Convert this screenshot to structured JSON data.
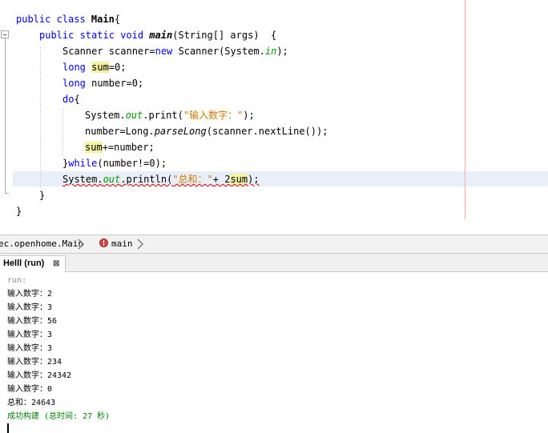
{
  "editor": {
    "lines": [
      {
        "segments": [
          {
            "t": "public class ",
            "c": "kw"
          },
          {
            "t": "Main",
            "c": "kw-bold"
          },
          {
            "t": "{"
          }
        ]
      },
      {
        "segments": [
          {
            "t": "public static void ",
            "c": "kw"
          },
          {
            "t": "main",
            "c": "kw-bold mth"
          },
          {
            "t": "(String[] args)  {"
          }
        ]
      },
      {
        "segments": [
          {
            "t": "Scanner scanner="
          },
          {
            "t": "new ",
            "c": "kw"
          },
          {
            "t": "Scanner(System."
          },
          {
            "t": "in",
            "c": "fld"
          },
          {
            "t": ");"
          }
        ]
      },
      {
        "segments": [
          {
            "t": "long ",
            "c": "kw"
          },
          {
            "t": "sum",
            "c": "mark"
          },
          {
            "t": "=0;"
          }
        ]
      },
      {
        "segments": [
          {
            "t": "long ",
            "c": "kw"
          },
          {
            "t": "number=0;"
          }
        ]
      },
      {
        "segments": [
          {
            "t": "do",
            "c": "kw"
          },
          {
            "t": "{"
          }
        ]
      },
      {
        "segments": [
          {
            "t": "System."
          },
          {
            "t": "out",
            "c": "fld"
          },
          {
            "t": ".print("
          },
          {
            "t": "\"输入数字：\"",
            "c": "str"
          },
          {
            "t": ");"
          }
        ]
      },
      {
        "segments": [
          {
            "t": "number=Long."
          },
          {
            "t": "parseLong",
            "c": "mth"
          },
          {
            "t": "(scanner.nextLine());"
          }
        ]
      },
      {
        "segments": [
          {
            "t": "sum",
            "c": "mark"
          },
          {
            "t": "+=number;"
          }
        ]
      },
      {
        "segments": [
          {
            "t": "}"
          },
          {
            "t": "while",
            "c": "kw"
          },
          {
            "t": "(number!=0);"
          }
        ]
      },
      {
        "segments": [
          {
            "t": "System."
          },
          {
            "t": "out",
            "c": "fld"
          },
          {
            "t": ".println("
          },
          {
            "t": "\"总和：\"",
            "c": "str"
          },
          {
            "t": "+ 2"
          },
          {
            "t": "sum",
            "c": "mark"
          },
          {
            "t": ");"
          }
        ],
        "error": true
      },
      {
        "segments": [
          {
            "t": "}"
          }
        ]
      },
      {
        "segments": [
          {
            "t": "}"
          }
        ]
      }
    ]
  },
  "breadcrumb": {
    "class_crumb": "ec.openhome.Main",
    "method_crumb": "main"
  },
  "output_tab": {
    "label": "Helll (run)",
    "close": "⊠"
  },
  "output": {
    "run_label": "run:",
    "lines": [
      "输入数字：2",
      "输入数字：3",
      "输入数字：56",
      "输入数字：3",
      "输入数字：3",
      "输入数字：234",
      "输入数字：24342",
      "输入数字：0",
      "总和：24643"
    ],
    "build_status": "成功构建 (总时间: 27 秒)"
  },
  "colors": {
    "keyword": "#0000e6",
    "field": "#009900",
    "string": "#ce7b00",
    "highlight": "#f2f1a4",
    "build_success": "#008000"
  }
}
